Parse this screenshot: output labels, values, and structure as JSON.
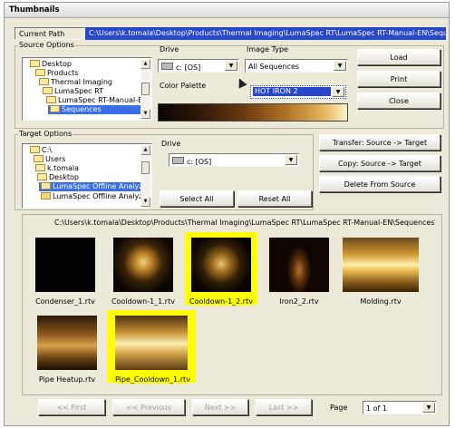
{
  "window": {
    "title": "Thumbnails"
  },
  "current_path": {
    "label": "Current Path",
    "value": "C:\\Users\\k.tomala\\Desktop\\Products\\Thermal Imaging\\LumaSpec RT\\LumaSpec RT-Manual-EN\\Sequence"
  },
  "source": {
    "label": "Source Options",
    "tree": [
      "Desktop",
      "Products",
      "Thermal Imaging",
      "LumaSpec RT",
      "LumaSpec RT-Manual-EN",
      "Sequences"
    ],
    "drive_label": "Drive",
    "drive_value": "c: [OS]",
    "image_type_label": "Image Type",
    "image_type_value": "All Sequences",
    "palette_label": "Color Palette",
    "palette_value": "HOT IRON 2"
  },
  "buttons": {
    "load": "Load",
    "print": "Print",
    "close": "Close",
    "transfer": "Transfer: Source -> Target",
    "copy": "Copy: Source -> Target",
    "delete": "Delete From Source",
    "select_all": "Select All",
    "reset_all": "Reset All"
  },
  "target": {
    "label": "Target Options",
    "tree": [
      "C:\\",
      "Users",
      "k.tomala",
      "Desktop",
      "LumaSpec Offline Analyzer",
      "LumaSpec Offline Analyzer"
    ],
    "drive_label": "Drive",
    "drive_value": "c: [OS]"
  },
  "gallery": {
    "path": "C:\\Users\\k.tomala\\Desktop\\Products\\Thermal Imaging\\LumaSpec RT\\LumaSpec RT-Manual-EN\\Sequences\\",
    "items": [
      {
        "name": "Condenser_1.rtv",
        "selected": false
      },
      {
        "name": "Cooldown-1_1.rtv",
        "selected": false
      },
      {
        "name": "Cooldown-1_2.rtv",
        "selected": true
      },
      {
        "name": "Iron2_2.rtv",
        "selected": false
      },
      {
        "name": "Molding.rtv",
        "selected": false
      },
      {
        "name": "Pipe Heatup.rtv",
        "selected": false
      },
      {
        "name": "Pipe_Cooldown_1.rtv",
        "selected": true
      }
    ]
  },
  "pager": {
    "first": "<< First",
    "previous": "<< Previous",
    "next": "Next >>",
    "last": "Last >>",
    "page_label": "Page",
    "page_value": "1 of 1"
  },
  "colors": {
    "selection": "#3a6ee8",
    "thumb_highlight": "#ffff00",
    "path_bar": "#2747c8"
  }
}
